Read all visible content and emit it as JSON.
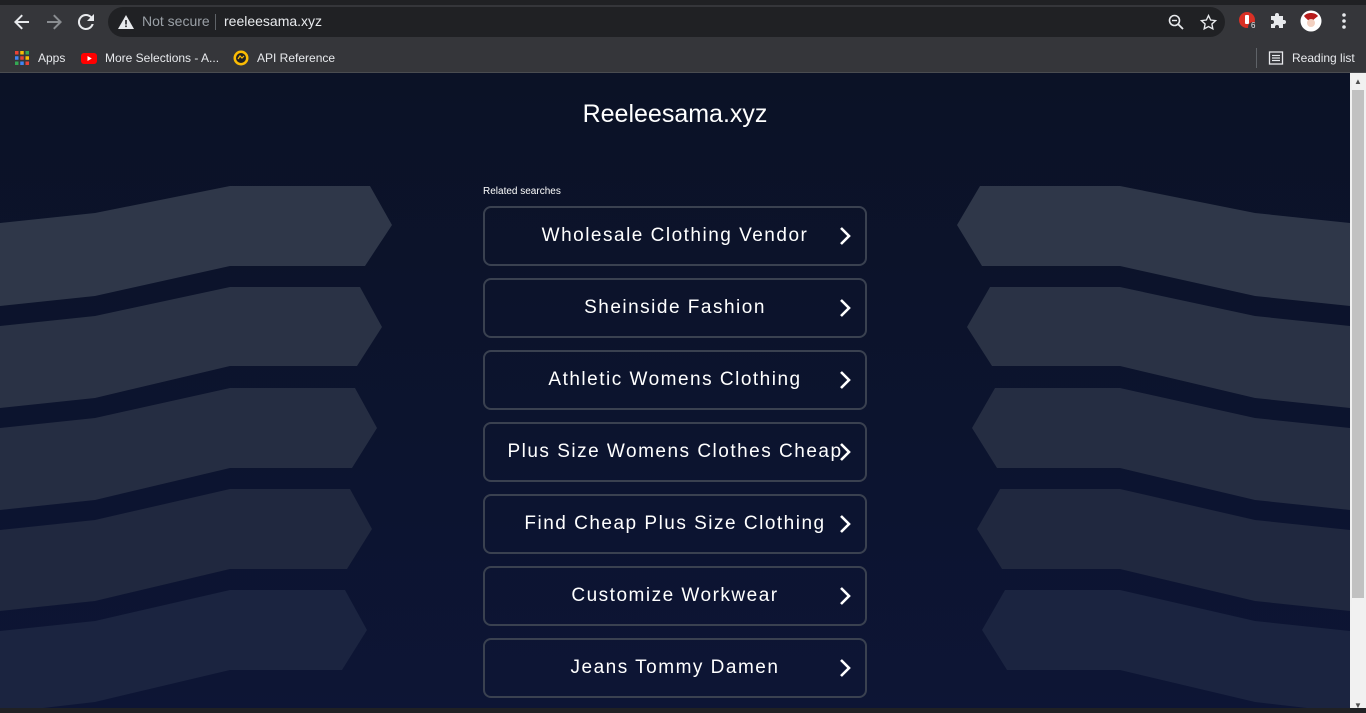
{
  "browser": {
    "security_label": "Not secure",
    "url": "reeleesama.xyz",
    "extension_badge": "6",
    "bookmarks": [
      {
        "label": "Apps",
        "icon": "apps-grid-icon"
      },
      {
        "label": "More Selections - A...",
        "icon": "youtube-icon"
      },
      {
        "label": "API Reference",
        "icon": "api-reference-icon"
      }
    ],
    "reading_list": "Reading list"
  },
  "page": {
    "title": "Reeleesama.xyz",
    "related_label": "Related searches",
    "searches": [
      "Wholesale Clothing Vendor",
      "Sheinside Fashion",
      "Athletic Womens Clothing",
      "Plus Size Womens Clothes Cheap",
      "Find Cheap Plus Size Clothing",
      "Customize Workwear",
      "Jeans Tommy Damen"
    ]
  },
  "colors": {
    "page_background": "#0b1226",
    "decor_shape": "#2b3347",
    "item_border": "#3a4150",
    "text": "#ffffff"
  }
}
